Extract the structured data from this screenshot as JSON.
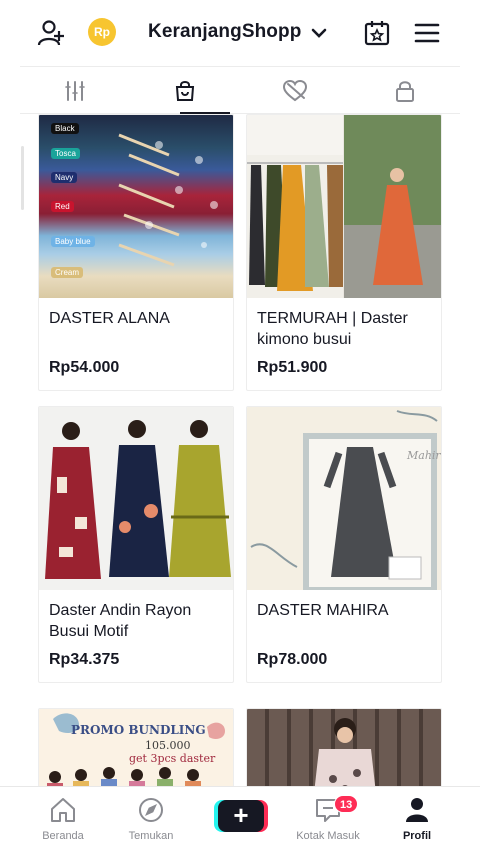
{
  "header": {
    "shop_name": "KeranjangShopp",
    "coin_label": "Rp",
    "icons": [
      "add-user-icon",
      "coin-icon",
      "chevron-down-icon",
      "calendar-star-icon",
      "menu-icon"
    ]
  },
  "tabs": [
    {
      "icon": "grid-icon",
      "active": false
    },
    {
      "icon": "shopping-bag-icon",
      "active": true
    },
    {
      "icon": "heart-hidden-icon",
      "active": false
    },
    {
      "icon": "lock-icon",
      "active": false
    }
  ],
  "products": [
    {
      "name": "DASTER ALANA",
      "price": "Rp54.000",
      "swatches": [
        "Black",
        "Tosca",
        "Navy",
        "Red",
        "Baby blue",
        "Cream"
      ]
    },
    {
      "name": "TERMURAH | Daster kimono busui",
      "price": "Rp51.900"
    },
    {
      "name": "Daster Andin Rayon Busui Motif",
      "price": "Rp34.375"
    },
    {
      "name": "DASTER MAHIRA",
      "price": "Rp78.000",
      "image_text": "Mahira"
    },
    {
      "name": "",
      "price": "",
      "promo_title": "PROMO BUNDLING",
      "promo_price": "105.000",
      "promo_sub": "get 3pcs daster"
    },
    {
      "name": "",
      "price": ""
    }
  ],
  "bottom_nav": {
    "items": [
      {
        "label": "Beranda",
        "icon": "home-icon"
      },
      {
        "label": "Temukan",
        "icon": "compass-icon"
      },
      {
        "label": "",
        "icon": "plus-icon"
      },
      {
        "label": "Kotak Masuk",
        "icon": "inbox-icon"
      },
      {
        "label": "Profil",
        "icon": "profile-icon"
      }
    ],
    "plus_label": "+",
    "inbox_badge": "13"
  },
  "colors": {
    "text": "#161823",
    "accent_red": "#fe2c55",
    "accent_cyan": "#25f4ee",
    "coin": "#f7c530"
  }
}
